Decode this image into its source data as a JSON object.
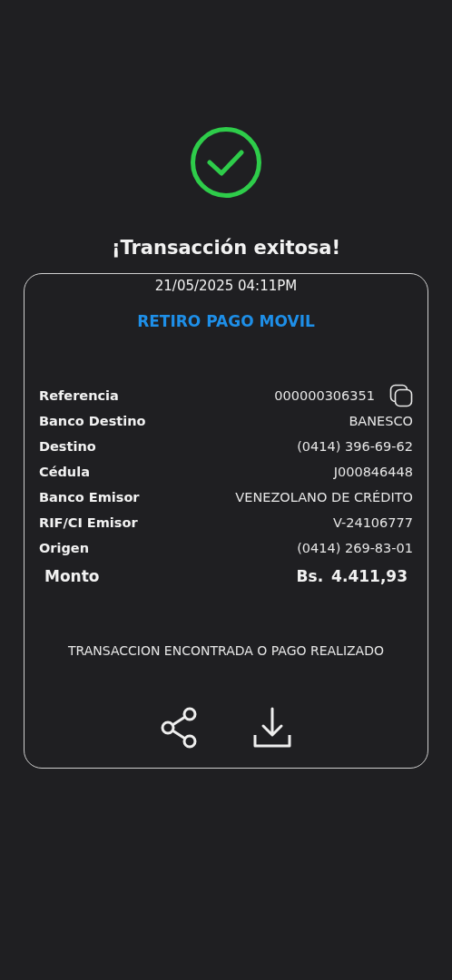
{
  "status": {
    "title": "¡Transacción exitosa!"
  },
  "receipt": {
    "date": "21/05/2025 04:11PM",
    "type": "RETIRO PAGO MOVIL",
    "details": [
      {
        "label": "Referencia",
        "value": "000000306351",
        "kind": "copyable"
      },
      {
        "label": "Banco Destino",
        "value": "BANESCO",
        "kind": "plain"
      },
      {
        "label": "Destino",
        "value": "(0414) 396-69-62",
        "kind": "plain"
      },
      {
        "label": "Cédula",
        "value": "J000846448",
        "kind": "plain"
      },
      {
        "label": "Banco Emisor",
        "value": "VENEZOLANO DE CRÉDITO",
        "kind": "plain"
      },
      {
        "label": "RIF/CI Emisor",
        "value": "V-24106777",
        "kind": "plain"
      },
      {
        "label": "Origen",
        "value": "(0414) 269-83-01",
        "kind": "plain"
      }
    ],
    "total": {
      "label": "Monto",
      "currency": "Bs.",
      "amount": "4.411,93"
    },
    "message": "TRANSACCION ENCONTRADA O PAGO REALIZADO"
  }
}
